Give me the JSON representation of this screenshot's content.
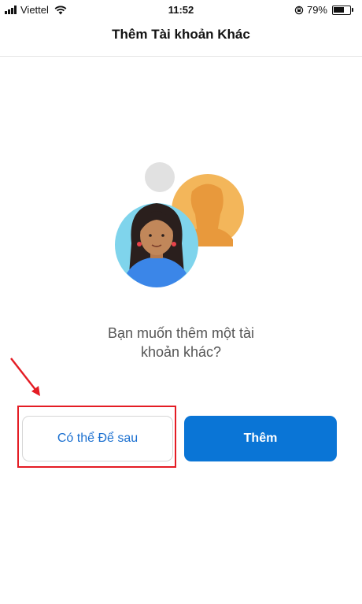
{
  "status_bar": {
    "carrier": "Viettel",
    "time": "11:52",
    "battery": "79%",
    "battery_level": 0.79,
    "icons": [
      "signal-icon",
      "wifi-icon",
      "rotation-lock-icon",
      "battery-icon"
    ]
  },
  "header": {
    "title": "Thêm Tài khoản Khác"
  },
  "illustration": {
    "icon": "add-account-people-icon"
  },
  "prompt": {
    "line1": "Bạn muốn thêm một tài",
    "line2": "khoản khác?"
  },
  "actions": {
    "later_label": "Có thể Để sau",
    "add_label": "Thêm"
  },
  "annotation": {
    "color": "#e41c24"
  },
  "colors": {
    "primary": "#0a75d6",
    "link": "#1a6fd0"
  }
}
